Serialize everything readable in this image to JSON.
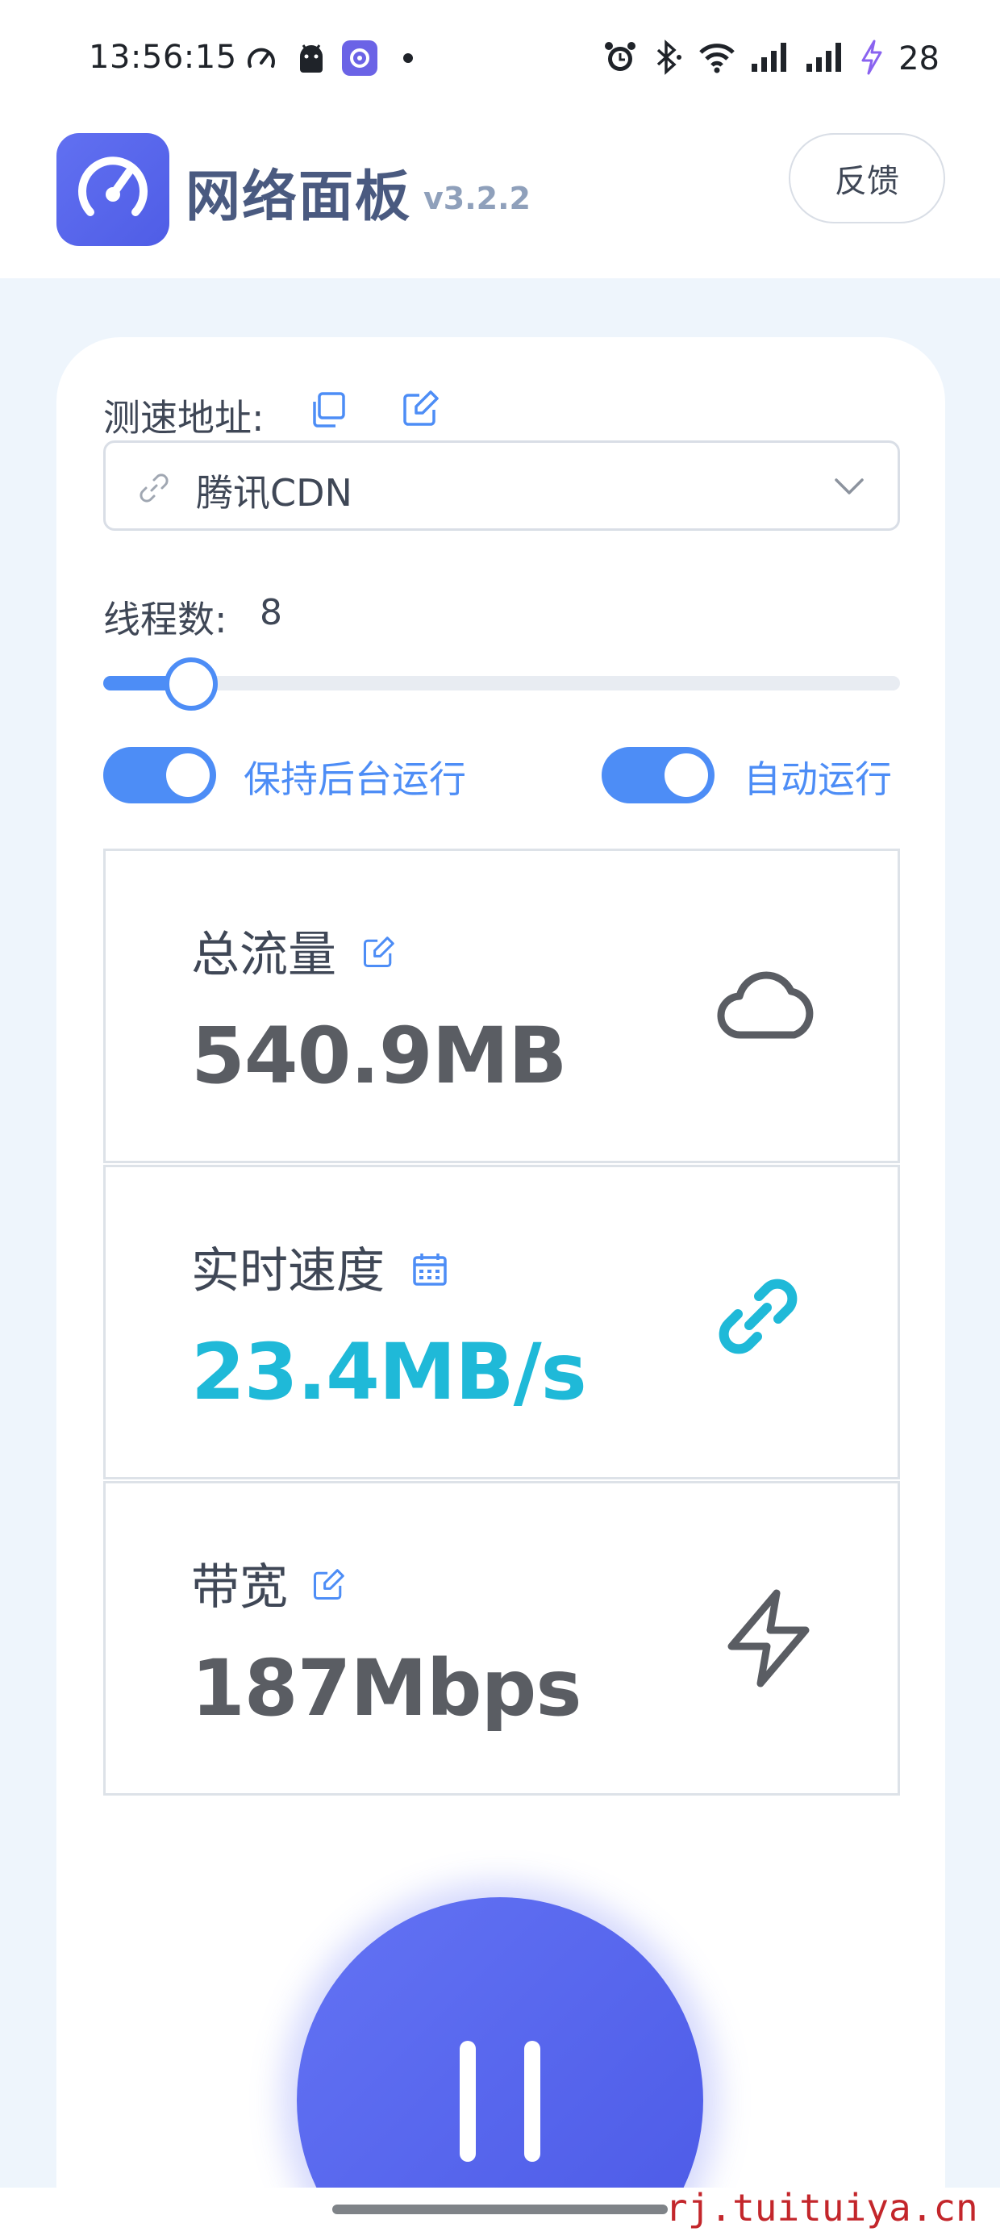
{
  "status_bar": {
    "time": "13:56:15",
    "battery": "28"
  },
  "header": {
    "app_title": "网络面板",
    "version": "v3.2.2",
    "feedback_label": "反馈"
  },
  "speed_url": {
    "label": "测速地址:",
    "selected": "腾讯CDN"
  },
  "threads": {
    "label": "线程数:",
    "value": "8",
    "slider_fraction": 0.11
  },
  "toggles": {
    "keep_background": {
      "label": "保持后台运行",
      "on": true
    },
    "auto_run": {
      "label": "自动运行",
      "on": true
    }
  },
  "stats": {
    "total_traffic": {
      "title": "总流量",
      "value": "540.9MB",
      "icon": "cloud-icon"
    },
    "realtime_speed": {
      "title": "实时速度",
      "value": "23.4MB/s",
      "icon": "link-icon"
    },
    "bandwidth": {
      "title": "带宽",
      "value": "187Mbps",
      "icon": "lightning-icon"
    }
  },
  "colors": {
    "accent": "#4d8df6",
    "brand": "#5563ec",
    "speed": "#1fb9d8"
  },
  "watermark": "rj.tuituiya.cn"
}
